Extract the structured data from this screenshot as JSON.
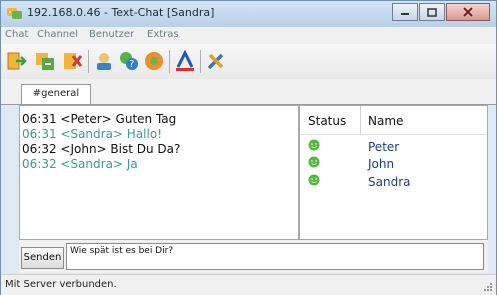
{
  "window": {
    "title": "192.168.0.46 - Text-Chat [Sandra]"
  },
  "menu": {
    "items": [
      "Chat",
      "Channel",
      "Benutzer",
      "Extras"
    ]
  },
  "toolbar": {
    "icons": [
      "connect-icon",
      "channel-icon",
      "leave-icon",
      "users-icon",
      "help-icon",
      "info-icon",
      "font-icon",
      "settings-icon"
    ]
  },
  "tabs": [
    {
      "label": "#general"
    }
  ],
  "chat": {
    "messages": [
      {
        "text": "06:31 <Peter> Guten Tag",
        "color": "#111111"
      },
      {
        "text": "06:31 <Sandra> Hallo!",
        "color": "#3a9a9a"
      },
      {
        "text": "06:32 <John> Bist Du Da?",
        "color": "#111111"
      },
      {
        "text": "06:32 <Sandra> Ja",
        "color": "#3a9a9a"
      }
    ]
  },
  "userlist": {
    "headers": {
      "status": "Status",
      "name": "Name"
    },
    "users": [
      {
        "name": "Peter"
      },
      {
        "name": "John"
      },
      {
        "name": "Sandra"
      }
    ]
  },
  "input": {
    "send_label": "Senden",
    "value": "Wie spät ist es bei Dir?"
  },
  "statusbar": {
    "text": "Mit Server verbunden."
  }
}
